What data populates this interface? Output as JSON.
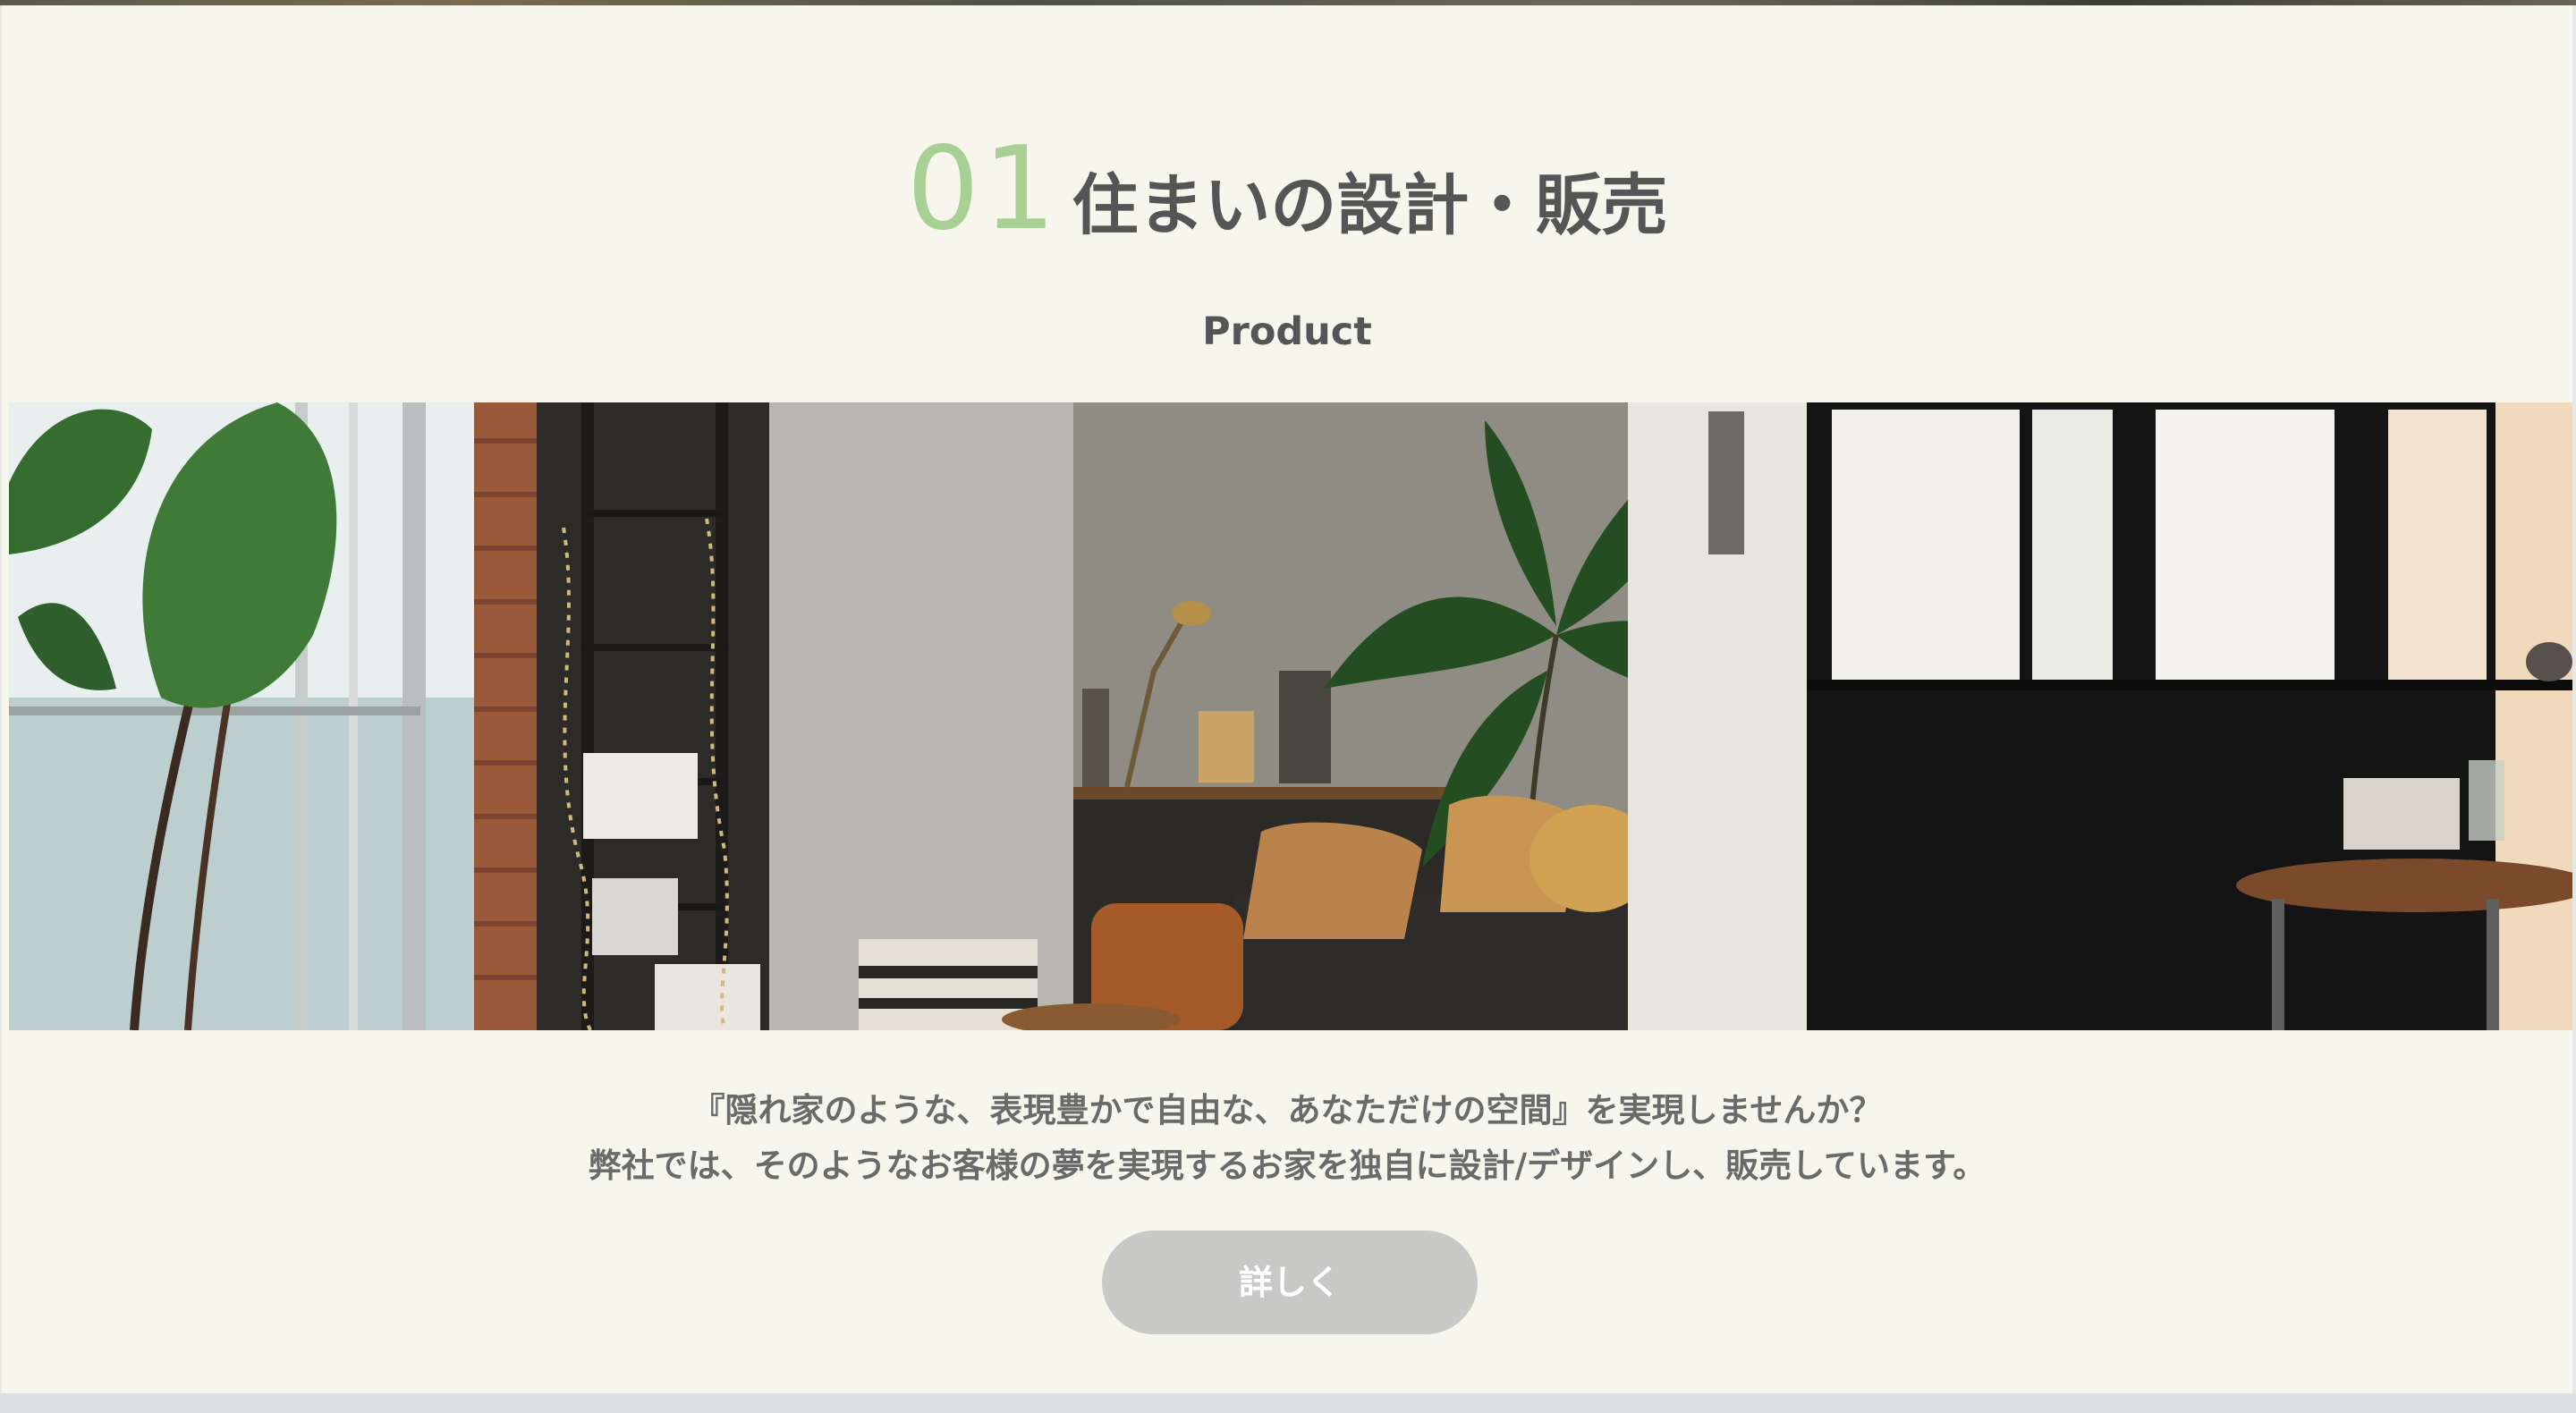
{
  "section": {
    "number": "01",
    "title": "住まいの設計・販売",
    "subtitle": "Product",
    "image_alt": "Interior photo: living space with plants, sofa, concrete wall and steel-framed windows",
    "description_line1": "『隠れ家のような、表現豊かで自由な、あなただけの空間』を実現しませんか？",
    "description_line2": "弊社では、そのようなお客様の夢を実現するお家を独自に設計/デザインし、販売しています。",
    "button_label": "詳しく"
  },
  "colors": {
    "background": "#f6f6ec",
    "number_accent": "#a8d095",
    "title_text": "#555555",
    "button_bg": "#c8c9c7",
    "button_text": "#ffffff"
  }
}
